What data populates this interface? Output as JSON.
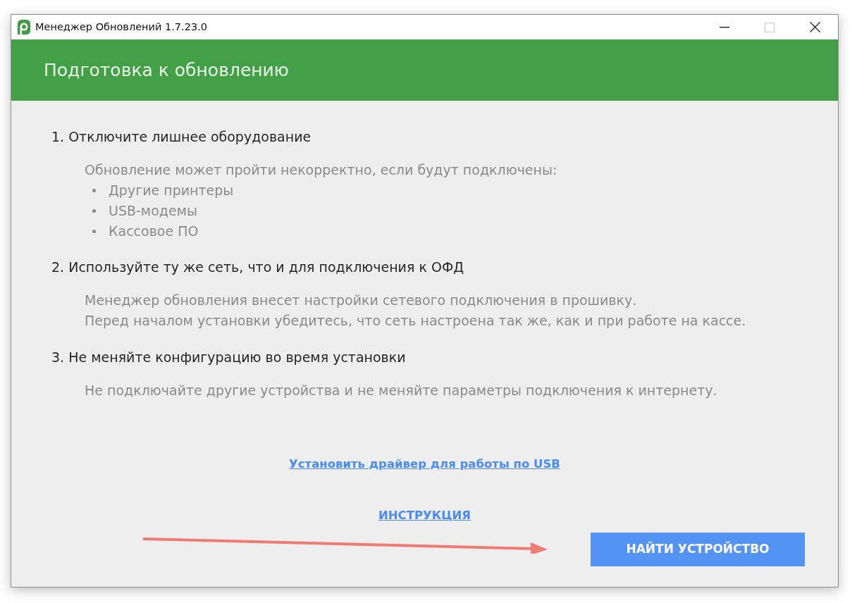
{
  "window": {
    "title": "Менеджер Обновлений 1.7.23.0",
    "controls": [
      {
        "kind": "minimize",
        "disabled": false
      },
      {
        "kind": "maximize",
        "disabled": true
      },
      {
        "kind": "close",
        "disabled": false
      }
    ]
  },
  "header": {
    "title": "Подготовка к обновлению"
  },
  "steps": [
    {
      "heading": "1. Отключите лишнее оборудование",
      "description": [
        "Обновление может пройти некорректно, если будут подключены:"
      ],
      "bullets": [
        "Другие принтеры",
        "USB-модемы",
        "Кассовое ПО"
      ]
    },
    {
      "heading": "2. Используйте ту же сеть, что и для подключения к ОФД",
      "description": [
        "Менеджер обновления внесет настройки сетевого подключения в прошивку.",
        "Перед началом установки убедитесь, что сеть настроена так же, как и при работе на кассе."
      ]
    },
    {
      "heading": "3. Не меняйте конфигурацию во время установки",
      "description": [
        "Не подключайте другие устройства и не меняйте параметры подключения к интернету."
      ]
    }
  ],
  "links": [
    "Установить драйвер для работы по USB",
    "ИНСТРУКЦИЯ"
  ],
  "button": {
    "label": "НАЙТИ УСТРОЙСТВО"
  }
}
